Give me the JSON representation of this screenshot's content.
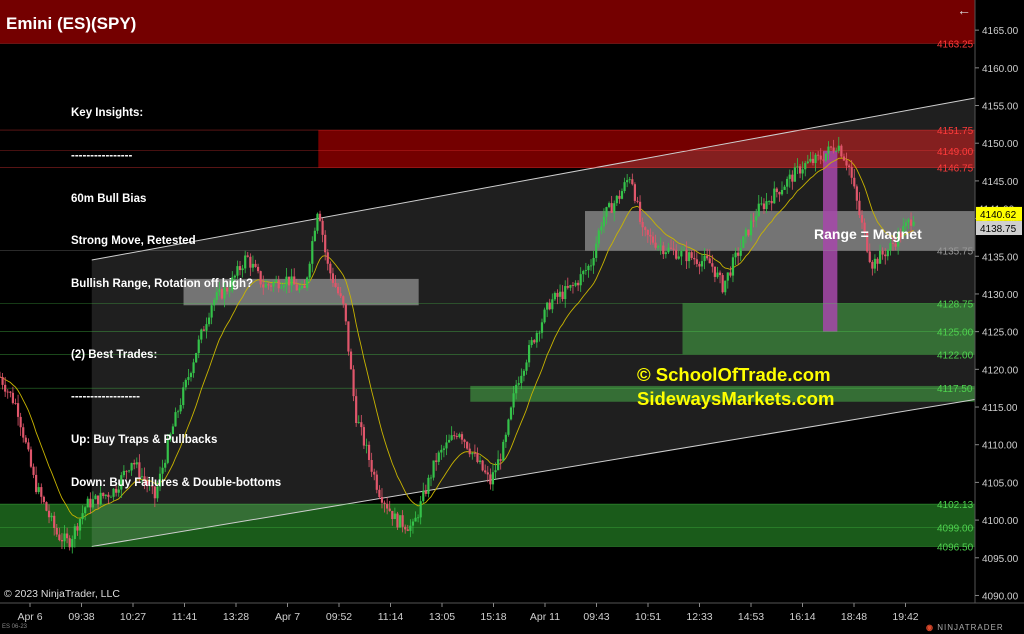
{
  "header": {
    "title": "Emini (ES)(SPY)",
    "back_arrow": "←"
  },
  "insights": {
    "lines": [
      "Key Insights:",
      "----------------",
      "60m Bull Bias",
      "Strong Move, Retested",
      "Bullish Range, Rotation off high?",
      "",
      "(2) Best Trades:",
      "------------------",
      "Up: Buy Traps & Pullbacks",
      "Down: Buy Failures & Double-bottoms"
    ]
  },
  "annotations": {
    "range_label": "Range = Magnet",
    "watermark_1": "© SchoolOfTrade.com",
    "watermark_2": "SidewaysMarkets.com",
    "copyright": "© 2023 NinjaTrader, LLC",
    "tiny_label": "ES 06-23",
    "logo_prefix": "◉",
    "logo_text": "NINJATRADER"
  },
  "colors": {
    "background": "#000000",
    "candle_up": "#35c24a",
    "candle_down": "#e0566b",
    "ema": "#c8b400",
    "resistance_zone": "#7a0000",
    "support_zone": "#1f6b1f",
    "range_box": "#8a8a8a",
    "purple_bar": "#9b2fa0",
    "price_axis_text": "#cfcfcf",
    "red_level_text": "#ff3b3b",
    "green_level_text": "#4fd34f",
    "current_price_badge": "#ffff00"
  },
  "chart_data": {
    "type": "candlestick",
    "symbol": "Emini (ES)(SPY)",
    "ylim": [
      4089,
      4169
    ],
    "y_ticks": [
      4090,
      4095,
      4100,
      4105,
      4110,
      4115,
      4120,
      4125,
      4130,
      4135,
      4140,
      4145,
      4150,
      4155,
      4160,
      4165
    ],
    "y_tick_labels": [
      "4090.00",
      "4095.00",
      "4100.00",
      "4105.00",
      "4110.00",
      "4115.00",
      "4120.00",
      "4125.00",
      "4130.00",
      "4135.00",
      "4140.00",
      "4145.00",
      "4150.00",
      "4155.00",
      "4160.00",
      "4165.00"
    ],
    "x_ticks": [
      "Apr 6",
      "09:38",
      "10:27",
      "11:41",
      "13:28",
      "Apr 7",
      "09:52",
      "11:14",
      "13:05",
      "15:18",
      "Apr 11",
      "09:43",
      "10:51",
      "12:33",
      "14:53",
      "16:14",
      "18:48",
      "19:42"
    ],
    "x_range": [
      0,
      17
    ],
    "last_bar_index": 15.2,
    "price_path": [
      [
        0,
        4119
      ],
      [
        0.3,
        4115
      ],
      [
        0.6,
        4105
      ],
      [
        1,
        4098
      ],
      [
        1.2,
        4097
      ],
      [
        1.5,
        4102
      ],
      [
        2,
        4104
      ],
      [
        2.3,
        4108
      ],
      [
        2.7,
        4103
      ],
      [
        3,
        4112
      ],
      [
        3.4,
        4122
      ],
      [
        3.7,
        4129
      ],
      [
        4,
        4131
      ],
      [
        4.3,
        4135
      ],
      [
        4.6,
        4131
      ],
      [
        5,
        4132
      ],
      [
        5.3,
        4130
      ],
      [
        5.55,
        4142
      ],
      [
        5.7,
        4134
      ],
      [
        6,
        4128
      ],
      [
        6.2,
        4114
      ],
      [
        6.6,
        4104
      ],
      [
        6.9,
        4100
      ],
      [
        7.2,
        4099
      ],
      [
        7.6,
        4108
      ],
      [
        8,
        4112
      ],
      [
        8.3,
        4108
      ],
      [
        8.55,
        4105
      ],
      [
        8.8,
        4110
      ],
      [
        9,
        4118
      ],
      [
        9.3,
        4124
      ],
      [
        9.6,
        4129
      ],
      [
        10,
        4131
      ],
      [
        10.3,
        4134
      ],
      [
        10.5,
        4140
      ],
      [
        10.8,
        4143
      ],
      [
        11,
        4146
      ],
      [
        11.2,
        4138
      ],
      [
        11.6,
        4136
      ],
      [
        12,
        4135
      ],
      [
        12.4,
        4134
      ],
      [
        12.6,
        4131
      ],
      [
        12.9,
        4136
      ],
      [
        13.2,
        4141
      ],
      [
        13.6,
        4144
      ],
      [
        14,
        4147
      ],
      [
        14.3,
        4148
      ],
      [
        14.6,
        4150
      ],
      [
        14.8,
        4147
      ],
      [
        15,
        4140
      ],
      [
        15.2,
        4134
      ],
      [
        15.5,
        4136
      ],
      [
        15.8,
        4139
      ],
      [
        15.95,
        4140.62
      ]
    ],
    "last_price": "4140.62",
    "current_price_badges": [
      "4141.00",
      "4140.62",
      "4138.75"
    ],
    "levels": [
      {
        "price": 4163.25,
        "label": "4163.25",
        "color": "red"
      },
      {
        "price": 4151.75,
        "label": "4151.75",
        "color": "red"
      },
      {
        "price": 4149.0,
        "label": "4149.00",
        "color": "red"
      },
      {
        "price": 4146.75,
        "label": "4146.75",
        "color": "red"
      },
      {
        "price": 4135.75,
        "label": "4135.75",
        "color": "gray"
      },
      {
        "price": 4128.75,
        "label": "4128.75",
        "color": "green"
      },
      {
        "price": 4125.0,
        "label": "4125.00",
        "color": "green"
      },
      {
        "price": 4122.0,
        "label": "4122.00",
        "color": "green"
      },
      {
        "price": 4117.5,
        "label": "4117.50",
        "color": "green"
      },
      {
        "price": 4102.13,
        "label": "4102.13",
        "color": "green"
      },
      {
        "price": 4099.0,
        "label": "4099.00",
        "color": "green"
      },
      {
        "price": 4096.5,
        "label": "4096.50",
        "color": "green"
      }
    ],
    "zones": [
      {
        "kind": "resistance",
        "from_x": 0,
        "to_x": 17,
        "y_low": 4163.25,
        "y_high": 4169
      },
      {
        "kind": "resistance",
        "from_x": 5.55,
        "to_x": 17,
        "y_low": 4146.75,
        "y_high": 4151.75
      },
      {
        "kind": "range",
        "from_x": 10.2,
        "to_x": 17,
        "y_low": 4135.75,
        "y_high": 4141
      },
      {
        "kind": "range",
        "from_x": 3.2,
        "to_x": 7.3,
        "y_low": 4128.5,
        "y_high": 4132
      },
      {
        "kind": "support",
        "from_x": 11.9,
        "to_x": 17,
        "y_low": 4122,
        "y_high": 4128.75
      },
      {
        "kind": "support",
        "from_x": 8.2,
        "to_x": 17,
        "y_low": 4115.7,
        "y_high": 4117.8
      },
      {
        "kind": "support",
        "from_x": 0,
        "to_x": 17,
        "y_low": 4096.5,
        "y_high": 4102.13
      },
      {
        "kind": "purple",
        "from_x": 14.35,
        "to_x": 14.6,
        "y_low": 4125,
        "y_high": 4149
      }
    ],
    "channel": {
      "upper": [
        [
          1.6,
          4134.5
        ],
        [
          17,
          4156
        ]
      ],
      "lower": [
        [
          1.6,
          4096.5
        ],
        [
          17,
          4116
        ]
      ]
    },
    "grid": false
  }
}
